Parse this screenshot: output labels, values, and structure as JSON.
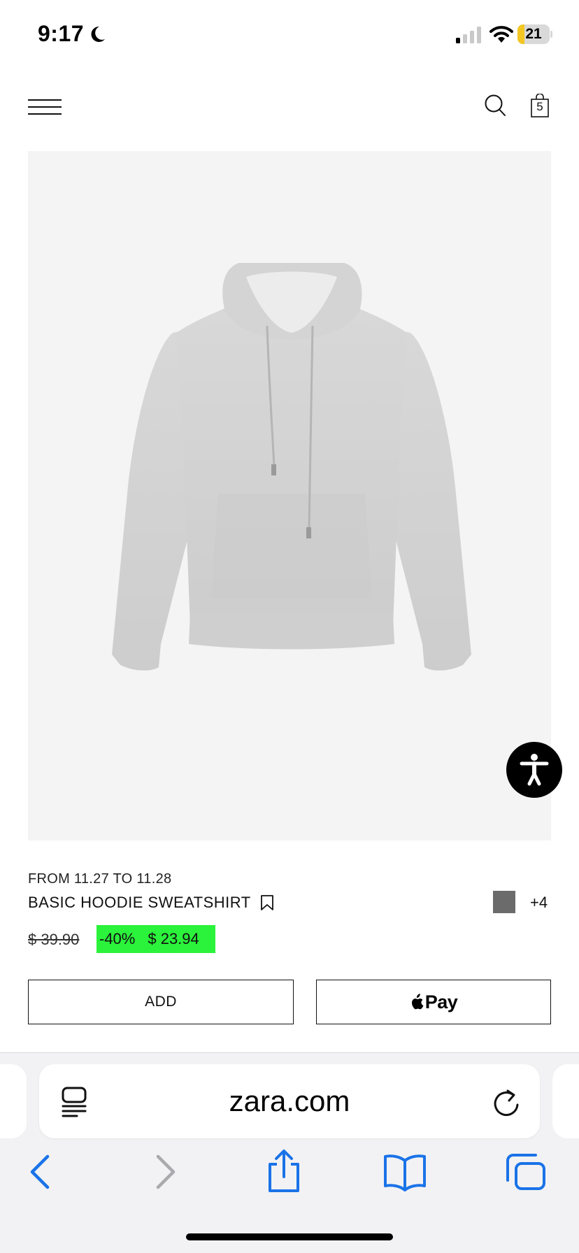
{
  "status_bar": {
    "time": "9:17",
    "focus_icon": "moon-icon",
    "signal_icon": "cellular-signal-icon",
    "wifi_icon": "wifi-icon",
    "battery_level": "21",
    "battery_fraction": 0.21,
    "battery_color": "#f3c623"
  },
  "header": {
    "menu_icon": "hamburger-menu-icon",
    "search_icon": "search-icon",
    "bag_icon": "shopping-bag-icon",
    "bag_count": "5"
  },
  "product": {
    "image_icon": "hoodie-product-image",
    "promo_dates": "FROM 11.27 TO 11.28",
    "name": "BASIC HOODIE SWEATSHIRT",
    "bookmark_icon": "bookmark-icon",
    "swatch_color": "#6b6b6b",
    "more_colors": "+4",
    "old_price": "$ 39.90",
    "discount": "-40%",
    "new_price": "$ 23.94",
    "sale_color": "#2bf23b",
    "add_label": "ADD",
    "pay_label": "Pay",
    "apple_icon": "apple-logo-icon"
  },
  "accessibility": {
    "icon": "accessibility-person-icon"
  },
  "browser": {
    "url": "zara.com",
    "reader_icon": "reader-mode-icon",
    "reload_icon": "reload-icon",
    "toolbar": [
      "back-icon",
      "forward-icon",
      "share-icon",
      "bookmarks-icon",
      "tabs-icon"
    ],
    "accent_color": "#1a73e8"
  }
}
